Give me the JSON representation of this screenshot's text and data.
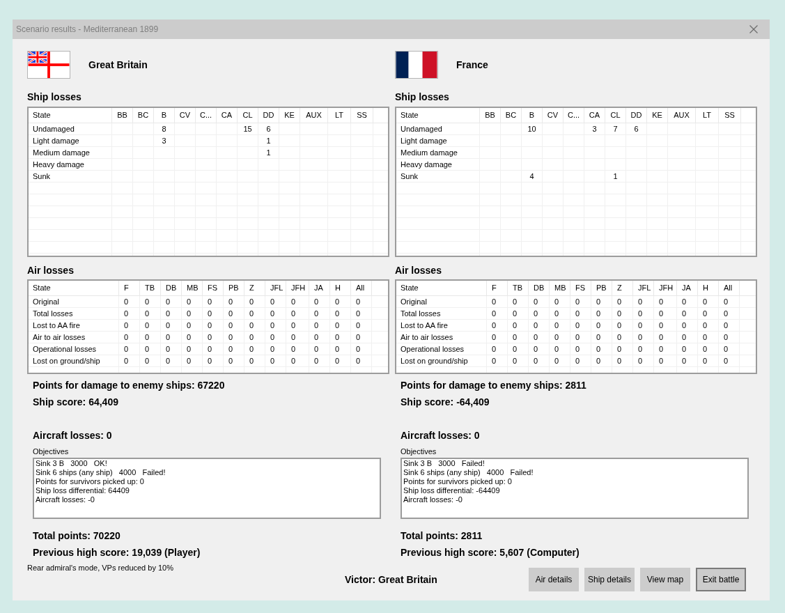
{
  "window": {
    "title": "Scenario results - Mediterranean 1899"
  },
  "sides": [
    {
      "name": "Great Britain",
      "flag": {
        "kind": "white_ensign"
      },
      "ship_losses": {
        "title": "Ship losses",
        "columns": [
          "State",
          "BB",
          "BC",
          "B",
          "CV",
          "C...",
          "CA",
          "CL",
          "DD",
          "KE",
          "AUX",
          "LT",
          "SS"
        ],
        "rows": [
          [
            "Undamaged",
            "",
            "",
            "8",
            "",
            "",
            "",
            "15",
            "6",
            "",
            "",
            "",
            ""
          ],
          [
            "Light damage",
            "",
            "",
            "3",
            "",
            "",
            "",
            "",
            "1",
            "",
            "",
            "",
            ""
          ],
          [
            "Medium damage",
            "",
            "",
            "",
            "",
            "",
            "",
            "",
            "1",
            "",
            "",
            "",
            ""
          ],
          [
            "Heavy damage",
            "",
            "",
            "",
            "",
            "",
            "",
            "",
            "",
            "",
            "",
            "",
            ""
          ],
          [
            "Sunk",
            "",
            "",
            "",
            "",
            "",
            "",
            "",
            "",
            "",
            "",
            "",
            ""
          ]
        ]
      },
      "air_losses": {
        "title": "Air losses",
        "columns": [
          "State",
          "F",
          "TB",
          "DB",
          "MB",
          "FS",
          "PB",
          "Z",
          "JFL",
          "JFH",
          "JA",
          "H",
          "All"
        ],
        "rows": [
          [
            "Original",
            "0",
            "0",
            "0",
            "0",
            "0",
            "0",
            "0",
            "0",
            "0",
            "0",
            "0",
            "0"
          ],
          [
            "Total losses",
            "0",
            "0",
            "0",
            "0",
            "0",
            "0",
            "0",
            "0",
            "0",
            "0",
            "0",
            "0"
          ],
          [
            "Lost to AA fire",
            "0",
            "0",
            "0",
            "0",
            "0",
            "0",
            "0",
            "0",
            "0",
            "0",
            "0",
            "0"
          ],
          [
            "Air to air losses",
            "0",
            "0",
            "0",
            "0",
            "0",
            "0",
            "0",
            "0",
            "0",
            "0",
            "0",
            "0"
          ],
          [
            "Operational losses",
            "0",
            "0",
            "0",
            "0",
            "0",
            "0",
            "0",
            "0",
            "0",
            "0",
            "0",
            "0"
          ],
          [
            "Lost on ground/ship",
            "0",
            "0",
            "0",
            "0",
            "0",
            "0",
            "0",
            "0",
            "0",
            "0",
            "0",
            "0"
          ]
        ]
      },
      "points_damage": "Points for damage to enemy ships: 67220",
      "ship_score": "Ship score: 64,409",
      "aircraft_losses": "Aircraft losses: 0",
      "objectives": {
        "label": "Objectives",
        "lines": [
          "Sink 3 B   3000   OK!",
          "Sink 6 ships (any ship)   4000   Failed!",
          "Points for survivors picked up: 0",
          "Ship loss differential: 64409",
          "Aircraft losses: -0"
        ]
      },
      "total_points": "Total points: 70220",
      "high_score": "Previous high score: 19,039 (Player)"
    },
    {
      "name": "France",
      "flag": {
        "kind": "french_tricolour"
      },
      "ship_losses": {
        "title": "Ship losses",
        "columns": [
          "State",
          "BB",
          "BC",
          "B",
          "CV",
          "C...",
          "CA",
          "CL",
          "DD",
          "KE",
          "AUX",
          "LT",
          "SS"
        ],
        "rows": [
          [
            "Undamaged",
            "",
            "",
            "10",
            "",
            "",
            "3",
            "7",
            "6",
            "",
            "",
            "",
            ""
          ],
          [
            "Light damage",
            "",
            "",
            "",
            "",
            "",
            "",
            "",
            "",
            "",
            "",
            "",
            ""
          ],
          [
            "Medium damage",
            "",
            "",
            "",
            "",
            "",
            "",
            "",
            "",
            "",
            "",
            "",
            ""
          ],
          [
            "Heavy damage",
            "",
            "",
            "",
            "",
            "",
            "",
            "",
            "",
            "",
            "",
            "",
            ""
          ],
          [
            "Sunk",
            "",
            "",
            "4",
            "",
            "",
            "",
            "1",
            "",
            "",
            "",
            "",
            ""
          ]
        ]
      },
      "air_losses": {
        "title": "Air losses",
        "columns": [
          "State",
          "F",
          "TB",
          "DB",
          "MB",
          "FS",
          "PB",
          "Z",
          "JFL",
          "JFH",
          "JA",
          "H",
          "All"
        ],
        "rows": [
          [
            "Original",
            "0",
            "0",
            "0",
            "0",
            "0",
            "0",
            "0",
            "0",
            "0",
            "0",
            "0",
            "0"
          ],
          [
            "Total losses",
            "0",
            "0",
            "0",
            "0",
            "0",
            "0",
            "0",
            "0",
            "0",
            "0",
            "0",
            "0"
          ],
          [
            "Lost to AA fire",
            "0",
            "0",
            "0",
            "0",
            "0",
            "0",
            "0",
            "0",
            "0",
            "0",
            "0",
            "0"
          ],
          [
            "Air to air losses",
            "0",
            "0",
            "0",
            "0",
            "0",
            "0",
            "0",
            "0",
            "0",
            "0",
            "0",
            "0"
          ],
          [
            "Operational losses",
            "0",
            "0",
            "0",
            "0",
            "0",
            "0",
            "0",
            "0",
            "0",
            "0",
            "0",
            "0"
          ],
          [
            "Lost on ground/ship",
            "0",
            "0",
            "0",
            "0",
            "0",
            "0",
            "0",
            "0",
            "0",
            "0",
            "0",
            "0"
          ]
        ]
      },
      "points_damage": "Points for damage to enemy ships: 2811",
      "ship_score": "Ship score: -64,409",
      "aircraft_losses": "Aircraft losses: 0",
      "objectives": {
        "label": "Objectives",
        "lines": [
          "Sink 3 B   3000   Failed!",
          "Sink 6 ships (any ship)   4000   Failed!",
          "Points for survivors picked up: 0",
          "Ship loss differential: -64409",
          "Aircraft losses: -0"
        ]
      },
      "total_points": "Total points: 2811",
      "high_score": "Previous high score: 5,607 (Computer)"
    }
  ],
  "note": "Rear admiral's mode, VPs reduced by 10%",
  "victor": "Victor: Great Britain",
  "buttons": [
    {
      "label": "Air details",
      "focused": false
    },
    {
      "label": "Ship details",
      "focused": false
    },
    {
      "label": "View map",
      "focused": false
    },
    {
      "label": "Exit battle",
      "focused": true
    }
  ]
}
